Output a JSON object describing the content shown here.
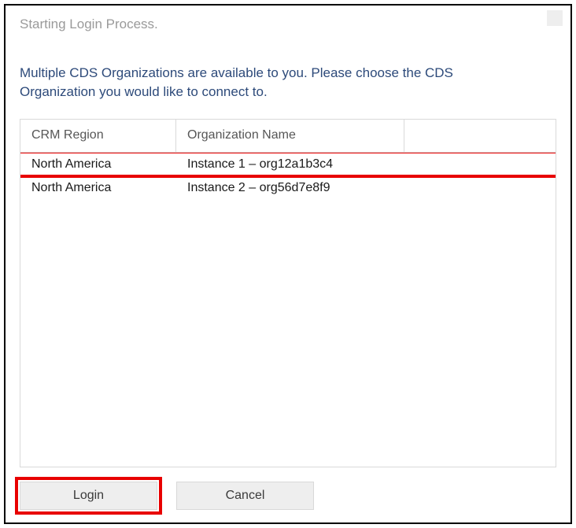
{
  "title": "Starting Login Process.",
  "description": "Multiple CDS Organizations are available to you. Please choose the CDS Organization you would like to connect to.",
  "table": {
    "headers": {
      "region": "CRM Region",
      "org": "Organization Name",
      "extra": ""
    },
    "rows": [
      {
        "region": "North America",
        "org": "Instance 1 – org12a1b3c4",
        "highlight": true
      },
      {
        "region": "North America",
        "org": "Instance 2 – org56d7e8f9",
        "highlight": false
      }
    ]
  },
  "buttons": {
    "login": "Login",
    "cancel": "Cancel"
  }
}
